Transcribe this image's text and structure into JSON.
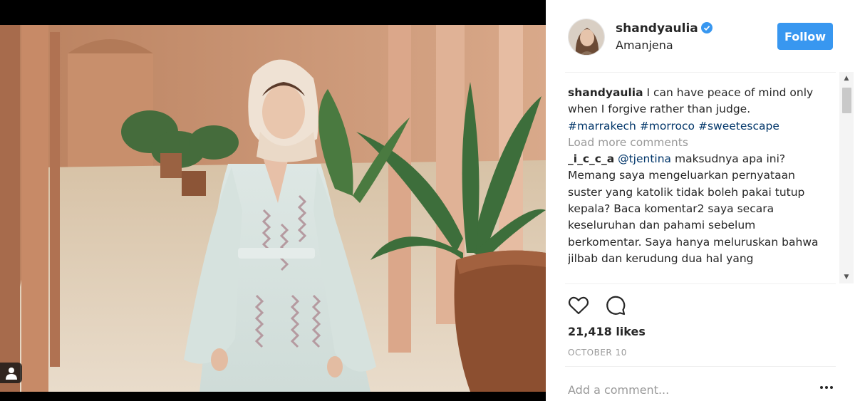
{
  "post": {
    "username": "shandyaulia",
    "location": "Amanjena",
    "follow_label": "Follow",
    "verified_icon": "verified-badge-icon",
    "likes": "21,418 likes",
    "date": "OCTOBER 10",
    "add_comment_placeholder": "Add a comment..."
  },
  "caption": {
    "username": "shandyaulia",
    "text": "I can have peace of mind only when I forgive rather than judge.",
    "hashtags": [
      "#marrakech",
      "#morroco",
      "#sweetescape"
    ]
  },
  "load_more_label": "Load more comments",
  "comments": [
    {
      "username": "_i_c_c_a",
      "mention": "@tjentina",
      "text": "maksudnya apa ini? Memang saya mengeluarkan pernyataan suster yang katolik tidak boleh pakai tutup kepala? Baca komentar2 saya secara keseluruhan dan pahami sebelum berkomentar. Saya hanya meluruskan bahwa jilbab dan kerudung dua hal yang"
    }
  ],
  "icons": {
    "like": "heart-icon",
    "comment": "comment-icon",
    "more": "more-options-icon",
    "user_tag": "user-tag-icon"
  },
  "colors": {
    "follow": "#3897f0",
    "hashtag": "#003569",
    "muted": "#999999",
    "text": "#262626"
  }
}
